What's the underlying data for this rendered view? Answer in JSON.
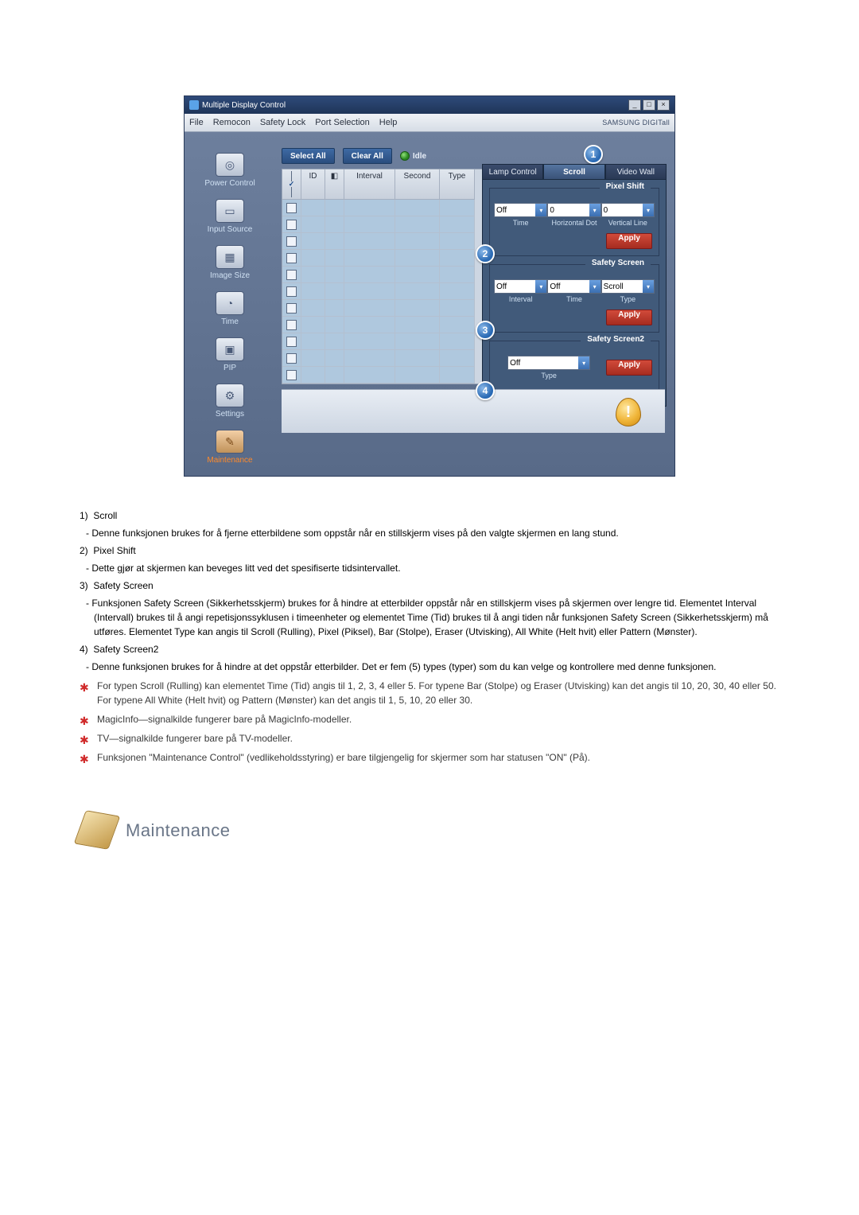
{
  "window": {
    "title": "Multiple Display Control",
    "brand": "SAMSUNG DIGITall"
  },
  "menu": [
    "File",
    "Remocon",
    "Safety Lock",
    "Port Selection",
    "Help"
  ],
  "sidebar": [
    {
      "label": "Power Control",
      "icon": "◎"
    },
    {
      "label": "Input Source",
      "icon": "▭"
    },
    {
      "label": "Image Size",
      "icon": "▦"
    },
    {
      "label": "Time",
      "icon": "◔"
    },
    {
      "label": "PIP",
      "icon": "▣"
    },
    {
      "label": "Settings",
      "icon": "⚙"
    },
    {
      "label": "Maintenance",
      "icon": "✎",
      "active": true
    }
  ],
  "toolbar": {
    "select_all": "Select All",
    "clear_all": "Clear All",
    "idle": "Idle"
  },
  "table": {
    "headers": [
      "",
      "ID",
      "",
      "Interval",
      "Second",
      "Type"
    ],
    "row_count": 11
  },
  "tabs": [
    "Lamp Control",
    "Scroll",
    "Video Wall"
  ],
  "active_tab": 1,
  "pixel_shift": {
    "title": "Pixel Shift",
    "time_label": "Time",
    "hdot_label": "Horizontal Dot",
    "vline_label": "Vertical Line",
    "time_value": "Off",
    "hdot_value": "0",
    "vline_value": "0",
    "apply": "Apply"
  },
  "safety_screen": {
    "title": "Safety Screen",
    "interval_label": "Interval",
    "time_label": "Time",
    "type_label": "Type",
    "interval_value": "Off",
    "time_value": "Off",
    "type_value": "Scroll",
    "apply": "Apply"
  },
  "safety_screen2": {
    "title": "Safety Screen2",
    "type_label": "Type",
    "type_value": "Off",
    "apply": "Apply"
  },
  "bubbles": [
    "1",
    "2",
    "3",
    "4"
  ],
  "explain": {
    "i1_title": "Scroll",
    "i1_body": "Denne funksjonen brukes for å fjerne etterbildene som oppstår når en stillskjerm vises på den valgte skjermen en lang stund.",
    "i2_title": "Pixel Shift",
    "i2_body": "Dette gjør at skjermen kan beveges litt ved det spesifiserte tidsintervallet.",
    "i3_title": "Safety Screen",
    "i3_body": "Funksjonen Safety Screen (Sikkerhetsskjerm) brukes for å hindre at etterbilder oppstår når en stillskjerm vises på skjermen over lengre tid.  Elementet Interval (Intervall) brukes til å angi repetisjonssyklusen i timeenheter og elementet Time (Tid) brukes til å angi tiden når funksjonen Safety Screen (Sikkerhetsskjerm) må utføres. Elementet Type kan angis til Scroll (Rulling), Pixel (Piksel), Bar (Stolpe), Eraser (Utvisking), All White (Helt hvit) eller Pattern (Mønster).",
    "i4_title": "Safety Screen2",
    "i4_body": "Denne funksjonen brukes for å hindre at det oppstår etterbilder. Det er fem (5) types (typer) som du kan velge og kontrollere med denne funksjonen.",
    "s1": "For typen Scroll (Rulling) kan elementet Time (Tid) angis til 1, 2, 3, 4 eller 5. For typene Bar (Stolpe) og Eraser (Utvisking) kan det angis til 10, 20, 30, 40 eller 50. For typene All White (Helt hvit) og Pattern (Mønster) kan det angis til 1, 5, 10, 20 eller 30.",
    "s2": "MagicInfo—signalkilde fungerer bare på MagicInfo-modeller.",
    "s3": "TV—signalkilde fungerer bare på TV-modeller.",
    "s4": "Funksjonen \"Maintenance Control\" (vedlikeholdsstyring) er bare tilgjengelig for skjermer som har statusen \"ON\" (På)."
  },
  "section_heading": "Maintenance"
}
